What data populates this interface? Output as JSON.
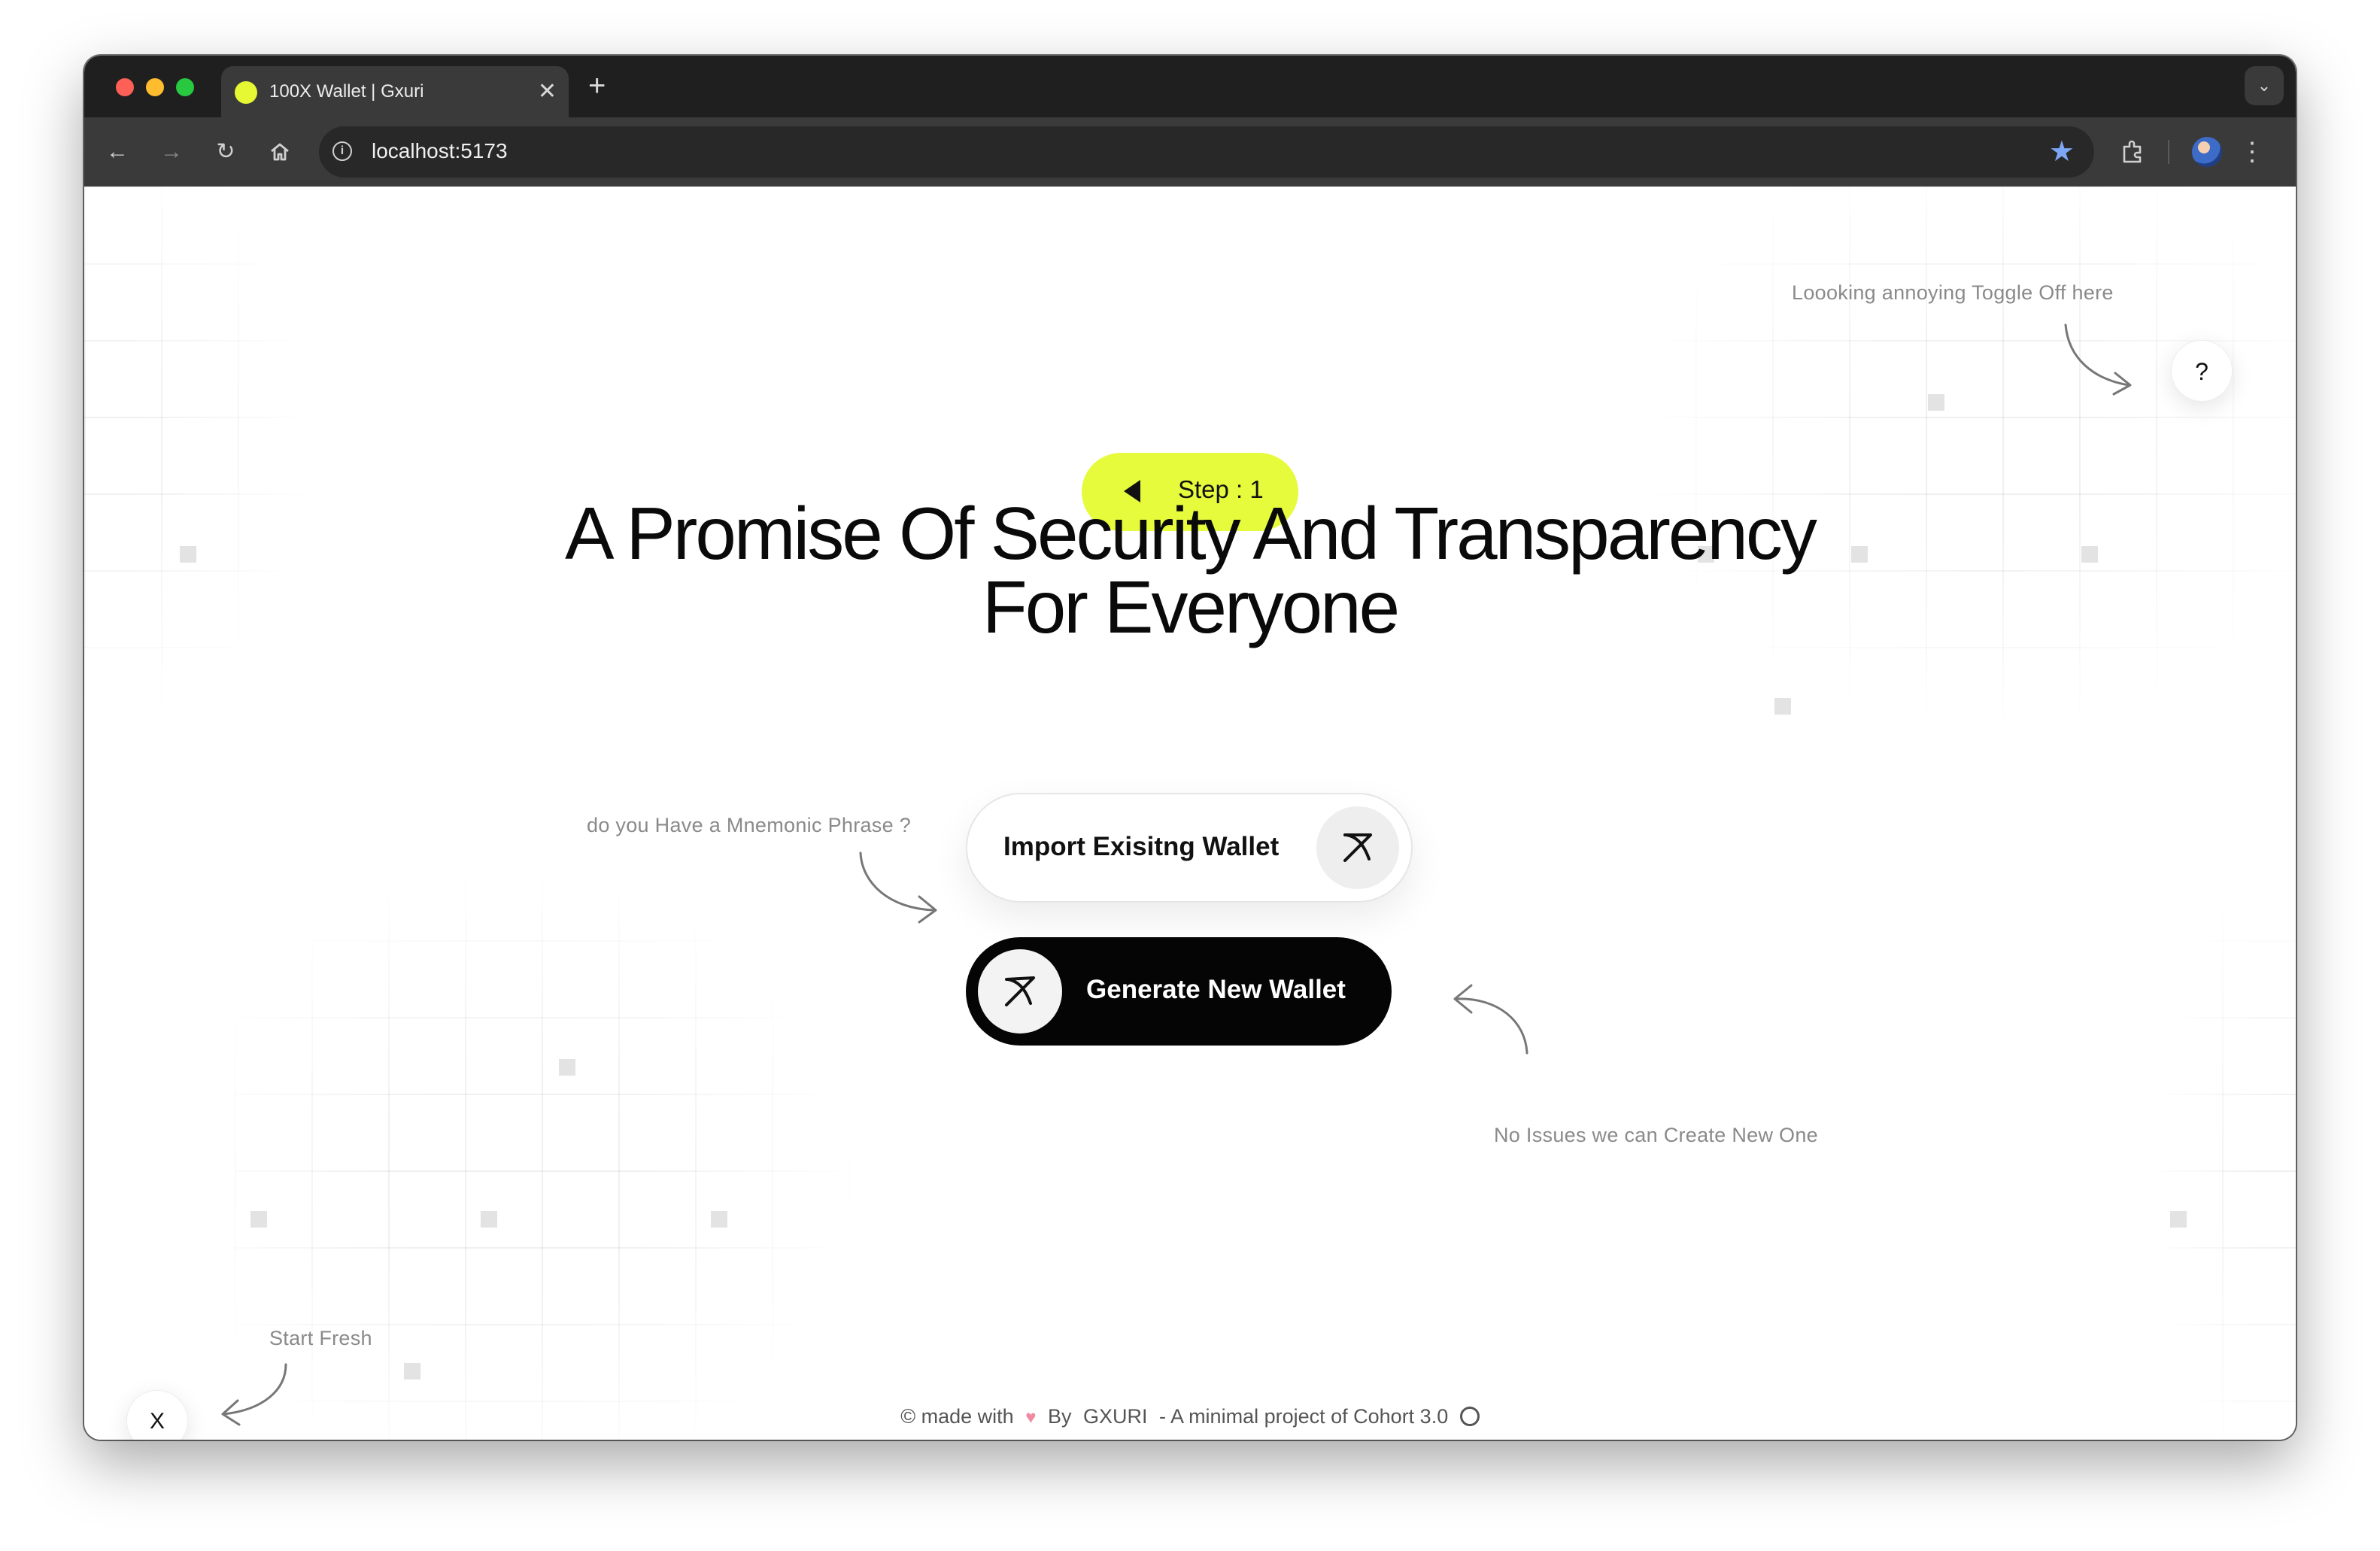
{
  "browser": {
    "tab_title": "100X Wallet | Gxuri",
    "tab_close": "✕",
    "new_tab": "+",
    "url": "localhost:5173"
  },
  "page": {
    "toggle_hint": "Loooking annoying Toggle Off here",
    "help_label": "?",
    "step_label": "Step : 1",
    "headline_line1": "A Promise Of Security And Transparency",
    "headline_line2": "For Everyone",
    "mnemonic_hint": "do you Have a Mnemonic Phrase ?",
    "import_label": "Import Exisitng Wallet",
    "generate_label": "Generate New Wallet",
    "create_hint": "No Issues we can Create New One",
    "fresh_hint": "Start Fresh",
    "reset_label": "X"
  },
  "footer": {
    "made_with": "© made with",
    "by": "By",
    "author": "GXURI",
    "project": "- A minimal project of Cohort 3.0"
  },
  "colors": {
    "accent": "#e6fb3c",
    "primary_button": "#050505",
    "heart": "#f08aa0"
  },
  "icons": [
    "back-arrow-icon",
    "forward-arrow-icon",
    "reload-icon",
    "home-icon",
    "info-icon",
    "star-icon",
    "extensions-icon",
    "kebab-menu-icon",
    "chevron-down-icon",
    "diagonal-arrow-icon",
    "heart-icon",
    "github-icon"
  ]
}
